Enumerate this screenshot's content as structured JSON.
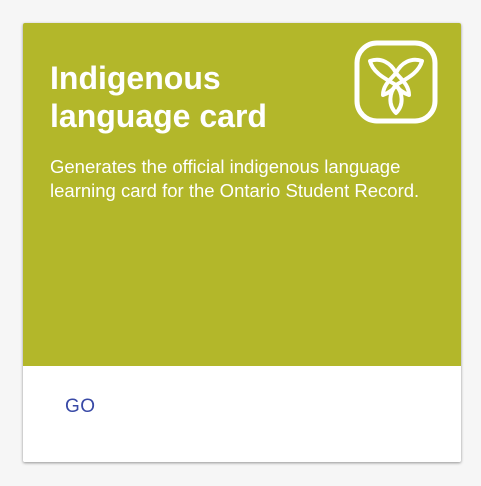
{
  "card": {
    "title": "Indigenous language card",
    "description": "Generates the official indigenous language learning card for the Ontario Student Record.",
    "logo_icon": "ontario-trillium-logo-icon",
    "header_color": "#b3b72a"
  },
  "actions": {
    "go_label": "GO",
    "go_color": "#3849a6"
  }
}
